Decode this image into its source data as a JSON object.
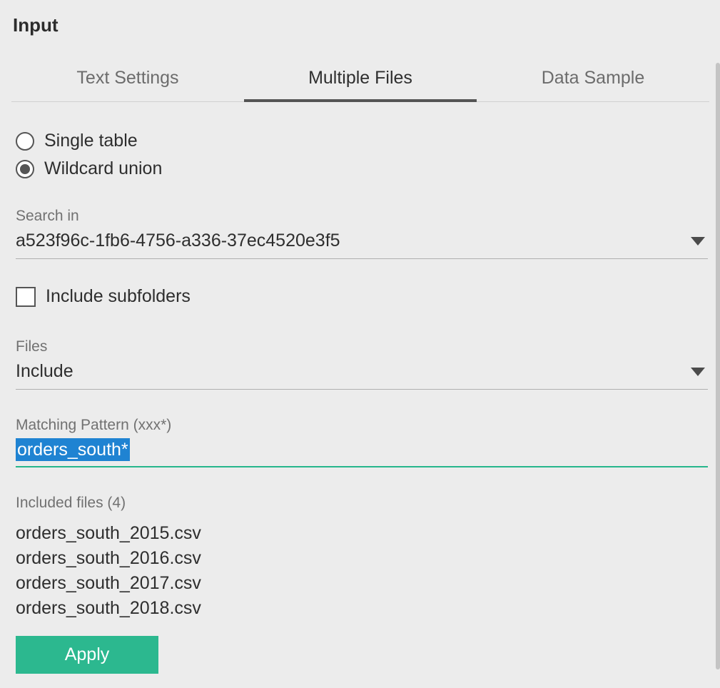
{
  "header": {
    "title": "Input"
  },
  "tabs": [
    {
      "label": "Text Settings",
      "active": false
    },
    {
      "label": "Multiple Files",
      "active": true
    },
    {
      "label": "Data Sample",
      "active": false
    }
  ],
  "radio": {
    "single_table": "Single table",
    "wildcard_union": "Wildcard union",
    "selected": "wildcard_union"
  },
  "search_in": {
    "label": "Search in",
    "value": "a523f96c-1fb6-4756-a336-37ec4520e3f5"
  },
  "include_subfolders": {
    "label": "Include subfolders",
    "checked": false
  },
  "files": {
    "label": "Files",
    "value": "Include"
  },
  "matching_pattern": {
    "label": "Matching Pattern (xxx*)",
    "value": "orders_south*"
  },
  "included_files": {
    "label": "Included files (4)",
    "items": [
      "orders_south_2015.csv",
      "orders_south_2016.csv",
      "orders_south_2017.csv",
      "orders_south_2018.csv"
    ]
  },
  "apply_button": "Apply"
}
